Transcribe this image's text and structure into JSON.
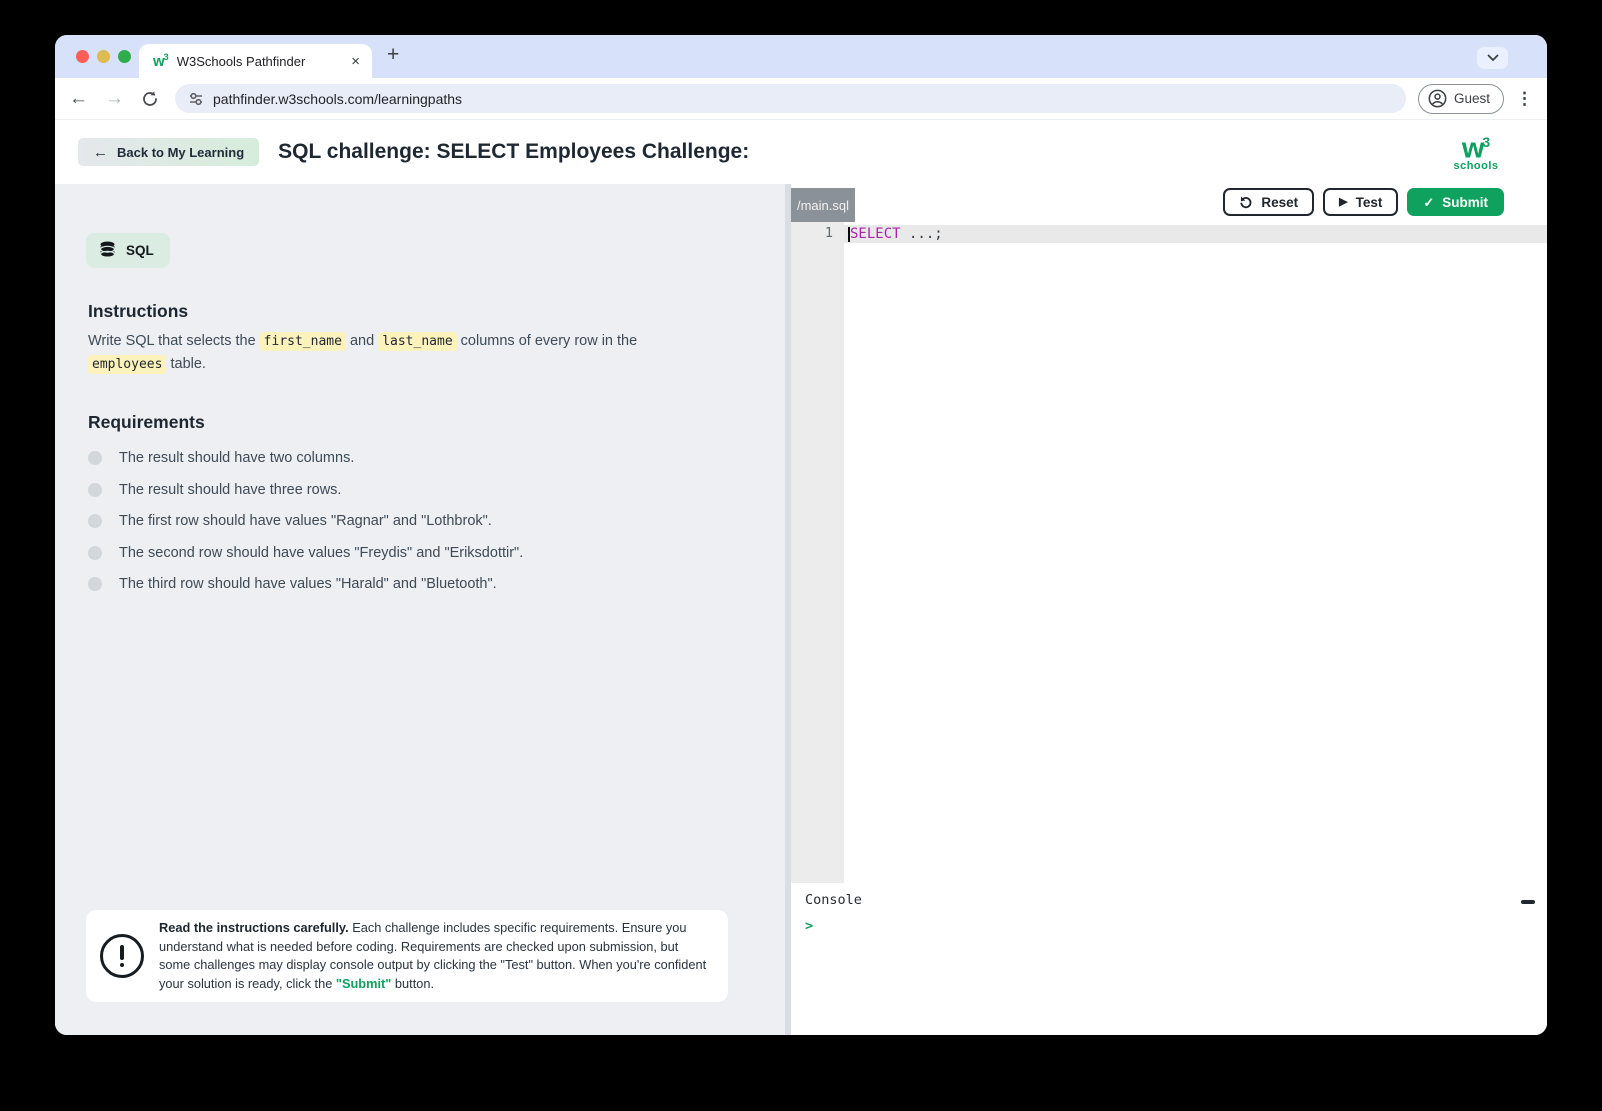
{
  "browser": {
    "tab_title": "W3Schools Pathfinder",
    "url": "pathfinder.w3schools.com/learningpaths",
    "guest_label": "Guest",
    "favicon_w": "w",
    "favicon_sup": "3"
  },
  "icons": {
    "close": "×",
    "plus": "+",
    "back_arrow": "←",
    "forward_arrow": "→",
    "menu_dots": "⋮",
    "left_arrow": "←",
    "play": "▶",
    "check": "✓",
    "prompt": ">"
  },
  "header": {
    "back_label": "Back to My Learning",
    "title": "SQL challenge: SELECT Employees Challenge:",
    "logo_w": "w",
    "logo_sup": "3",
    "logo_text": "schools"
  },
  "panel": {
    "badge_label": "SQL",
    "instructions_title": "Instructions",
    "instructions_segments": [
      {
        "t": "Write SQL that selects the "
      },
      {
        "t": "first_name",
        "s": "code"
      },
      {
        "t": " and "
      },
      {
        "t": "last_name",
        "s": "code"
      },
      {
        "t": " columns of every row in the "
      },
      {
        "t": "employees",
        "s": "code"
      },
      {
        "t": " table."
      }
    ],
    "requirements_title": "Requirements",
    "requirements": [
      "The result should have two columns.",
      "The result should have three rows.",
      "The first row should have values \"Ragnar\" and \"Lothbrok\".",
      "The second row should have values \"Freydis\" and \"Eriksdottir\".",
      "The third row should have values \"Harald\" and \"Bluetooth\"."
    ],
    "info_segments": [
      {
        "t": "Read the instructions carefully. ",
        "s": "b"
      },
      {
        "t": "Each challenge includes specific requirements. Ensure you understand what is needed before coding. Requirements are checked upon submission, but some challenges may display console output by clicking the \"Test\" button. When you're confident your solution is ready, click the "
      },
      {
        "t": "\"Submit\"",
        "s": "gb"
      },
      {
        "t": " button."
      }
    ]
  },
  "editor": {
    "file_tab": "/main.sql",
    "reset_label": "Reset",
    "test_label": "Test",
    "submit_label": "Submit",
    "line_number": "1",
    "code_keyword": "SELECT",
    "code_rest": " ...;"
  },
  "console": {
    "label": "Console",
    "prompt": ">"
  },
  "colors": {
    "accent_green": "#0ea15f",
    "keyword_purple": "#a626a4",
    "chip_yellow": "#fbf2bc",
    "panel_gray": "#edeff3"
  }
}
